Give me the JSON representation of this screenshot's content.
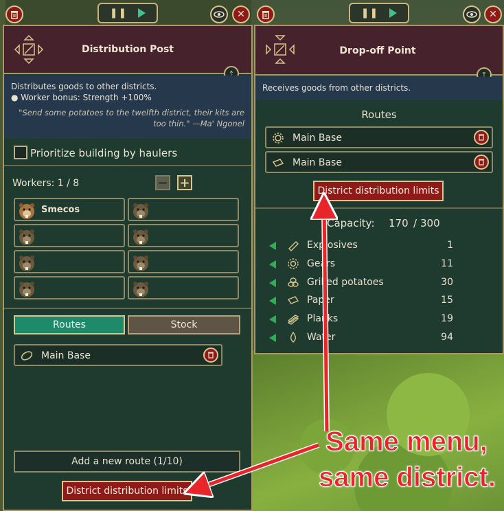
{
  "left_panel": {
    "title": "Distribution Post",
    "description_line1": "Distributes goods to other districts.",
    "description_line2": "● Worker bonus: Strength +100%",
    "quote": "\"Send some potatoes to the twelfth district, their kits are too thin.\" —Ma' Ngonel",
    "prioritize_label": "Prioritize building by haulers",
    "prioritize_checked": false,
    "workers_label": "Workers: 1 / 8",
    "minus_label": "−",
    "plus_label": "+",
    "worker_names": [
      "Smecos",
      "",
      "",
      "",
      "",
      "",
      "",
      ""
    ],
    "tabs": [
      {
        "label": "Routes",
        "active": true
      },
      {
        "label": "Stock",
        "active": false
      }
    ],
    "routes": [
      {
        "label": "Main Base",
        "icon": "potato-icon"
      }
    ],
    "add_route_label": "Add a new route (1/10)",
    "limits_label": "District distribution limits"
  },
  "right_panel": {
    "title": "Drop-off Point",
    "description": "Receives goods from other districts.",
    "routes_heading": "Routes",
    "routes": [
      {
        "label": "Main Base",
        "icon": "gear-icon"
      },
      {
        "label": "Main Base",
        "icon": "paper-icon"
      }
    ],
    "limits_label": "District distribution limits",
    "capacity_label": "Capacity:",
    "capacity_current": "170",
    "capacity_sep": "/",
    "capacity_max": "300",
    "goods": [
      {
        "name": "Explosives",
        "value": "1",
        "icon": "explosives-icon"
      },
      {
        "name": "Gears",
        "value": "11",
        "icon": "gear-icon"
      },
      {
        "name": "Grilled potatoes",
        "value": "30",
        "icon": "grilled-potatoes-icon"
      },
      {
        "name": "Paper",
        "value": "15",
        "icon": "paper-icon"
      },
      {
        "name": "Planks",
        "value": "19",
        "icon": "planks-icon"
      },
      {
        "name": "Water",
        "value": "94",
        "icon": "water-icon"
      }
    ]
  },
  "annotation": {
    "line1": "Same menu,",
    "line2": "same district."
  },
  "colors": {
    "accent_red": "#8e1a1a",
    "tab_active": "#1f8a6a",
    "annotation_red": "#e8262a"
  }
}
